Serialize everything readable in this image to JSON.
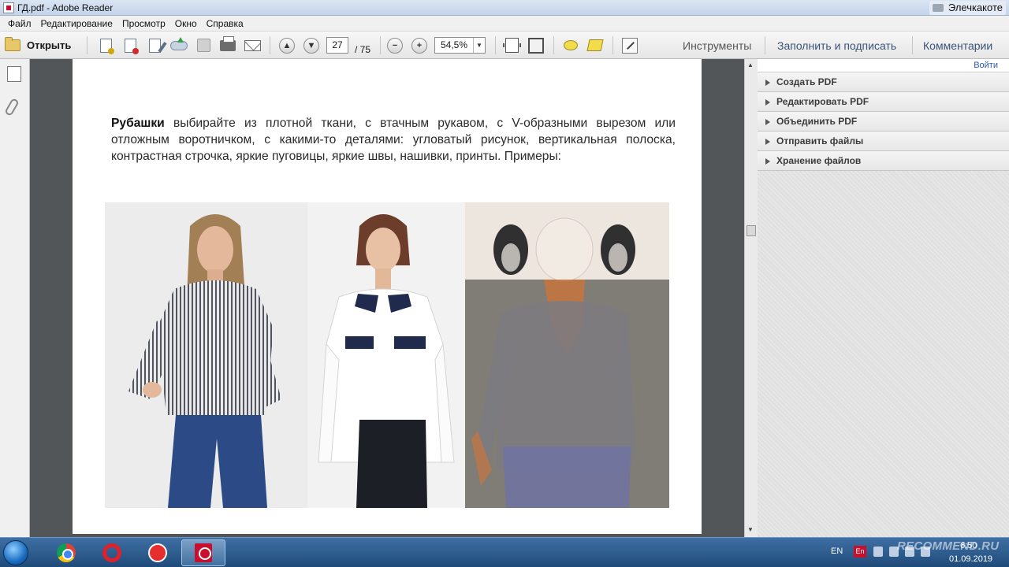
{
  "window": {
    "title": "ГД.pdf - Adobe Reader",
    "background_tab": "Элечкакоте"
  },
  "menu": [
    "Файл",
    "Редактирование",
    "Просмотр",
    "Окно",
    "Справка"
  ],
  "toolbar": {
    "open_label": "Открыть",
    "current_page": "27",
    "total_pages": "/ 75",
    "zoom": "54,5%",
    "tools_label": "Инструменты",
    "fill_sign_label": "Заполнить и подписать",
    "comments_label": "Комментарии"
  },
  "right_panel": {
    "sign_in": "Войти",
    "sections": [
      "Создать PDF",
      "Редактировать PDF",
      "Объединить PDF",
      "Отправить файлы",
      "Хранение файлов"
    ]
  },
  "document": {
    "bold_lead": "Рубашки",
    "paragraph": " выбирайте из плотной ткани, с втачным рукавом, с V-образными вырезом или отложным воротничком, с какими-то деталями: угловатый рисунок, вертикальная полоска, контрастная строчка, яркие пуговицы, яркие швы, нашивки, принты. Примеры:"
  },
  "taskbar": {
    "language": "EN",
    "lang_badge": "En",
    "time": "6:50",
    "date": "01.09.2019"
  },
  "watermark": "RECOMMEND.RU"
}
